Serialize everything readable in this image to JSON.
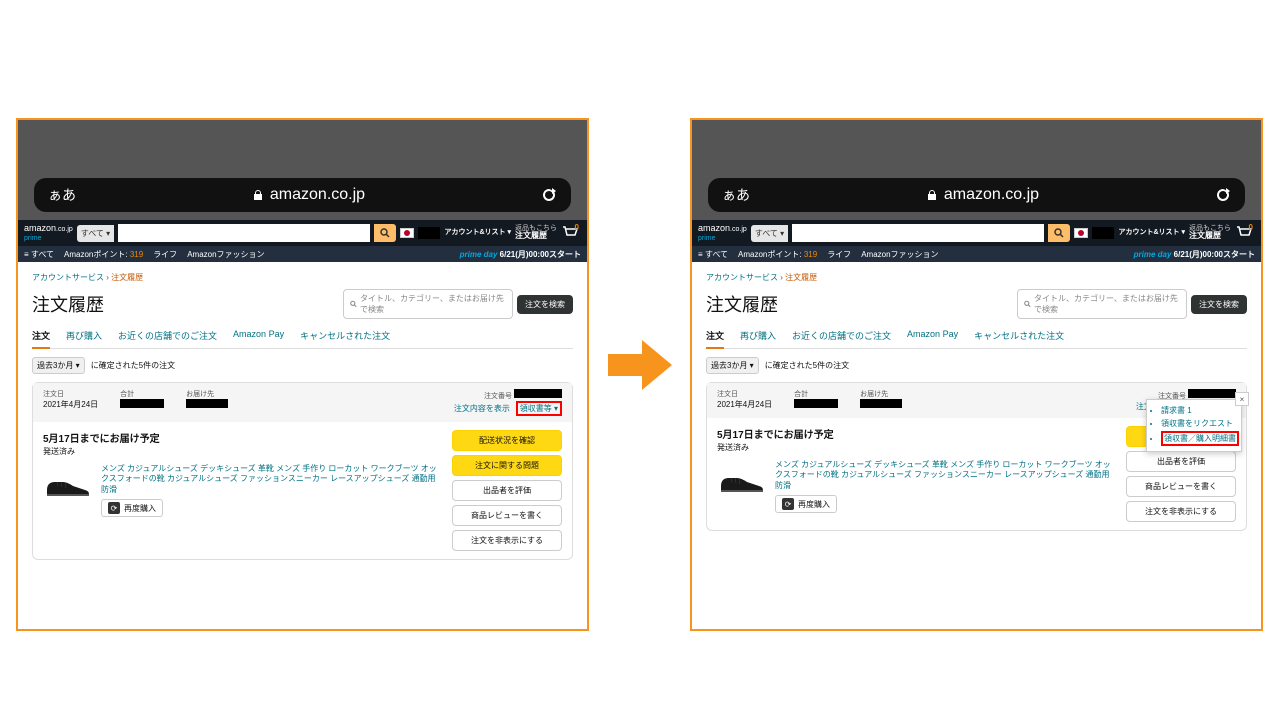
{
  "addrbar": {
    "left": "ぁあ",
    "domain": "amazon.co.jp"
  },
  "header": {
    "logo_top": "amazon",
    "logo_sub": ".co.jp",
    "logo_prime": "prime",
    "search_dd": "すべて ▾",
    "account_l1": "",
    "account_l2": "アカウント&リスト ▾",
    "returns_l1": "返品もこちら",
    "returns_l2": "注文履歴",
    "cart_count": "0"
  },
  "subnav": {
    "all": "≡ すべて",
    "points_label": "Amazonポイント:",
    "points_value": "319",
    "life": "ライフ",
    "fashion": "Amazonファッション",
    "primeday": "prime day",
    "date": "6/21(月)00:00スタート"
  },
  "crumb": {
    "a": "アカウントサービス",
    "sep": "›",
    "cur": "注文履歴"
  },
  "page_title": "注文履歴",
  "search_orders": {
    "placeholder": "タイトル、カテゴリー、またはお届け先で検索",
    "btn": "注文を検索"
  },
  "tabs": {
    "orders": "注文",
    "buyagain": "再び購入",
    "store": "お近くの店舗でのご注文",
    "pay": "Amazon Pay",
    "cancelled": "キャンセルされた注文"
  },
  "filter": {
    "period": "過去3か月 ▾",
    "summary": "に確定された5件の注文"
  },
  "order": {
    "date_lbl": "注文日",
    "date_val": "2021年4月24日",
    "total_lbl": "合計",
    "ship_lbl": "お届け先",
    "num_lbl": "注文番号",
    "detail_link": "注文内容を表示",
    "receipt_link": "領収書等 ▾",
    "delivery": "5月17日までにお届け予定",
    "shipped": "発送済み",
    "product": "メンズ カジュアルシューズ デッキシューズ 革靴 メンズ 手作り ローカット ワークブーツ オックスフォードの靴 カジュアルシューズ ファッションスニーカー レースアップシューズ 通勤用 防滑",
    "rebuy": "再度購入",
    "actions": {
      "track": "配送状況を確認",
      "problem": "注文に関する問題",
      "rateseller": "出品者を評価",
      "review": "商品レビューを書く",
      "hide": "注文を非表示にする"
    }
  },
  "receipt_menu": {
    "item1": "請求書 1",
    "item2": "領収書をリクエスト",
    "item3": "領収書／購入明細書"
  }
}
